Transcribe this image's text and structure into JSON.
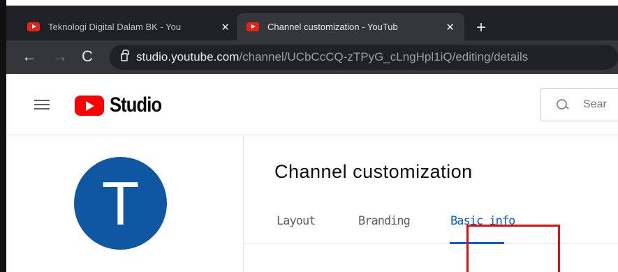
{
  "browser": {
    "tabs": [
      {
        "title": "Teknologi Digital Dalam BK - You",
        "close": "✕",
        "active": false
      },
      {
        "title": "Channel customization - YouTub",
        "close": "✕",
        "active": true
      }
    ],
    "new_tab": "+",
    "nav": {
      "back": "←",
      "forward": "→",
      "reload": "C"
    },
    "url_host": "studio.youtube.com",
    "url_path": "/channel/UCbCcCQ-zTPyG_cLngHpl1iQ/editing/details"
  },
  "header": {
    "logo_text": "Studio",
    "search_placeholder": "Sear"
  },
  "sidebar": {
    "avatar_letter": "T",
    "avatar_color": "#0f57a3"
  },
  "main": {
    "title": "Channel customization",
    "tabs": [
      {
        "label": "Layout",
        "selected": false
      },
      {
        "label": "Branding",
        "selected": false
      },
      {
        "label": "Basic info",
        "selected": true
      }
    ]
  },
  "colors": {
    "accent": "#065fd4",
    "brand_red": "#ff0000",
    "highlight": "#e01010"
  }
}
